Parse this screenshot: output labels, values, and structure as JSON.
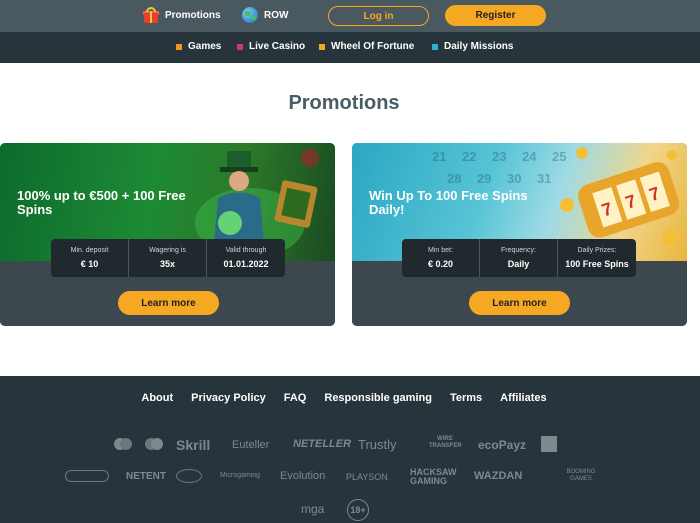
{
  "topbar": {
    "promotions_label": "Promotions",
    "region_label": "ROW",
    "login_label": "Log in",
    "register_label": "Register"
  },
  "nav": {
    "items": [
      {
        "label": "Games",
        "color": "#f5942a"
      },
      {
        "label": "Live Casino",
        "color": "#d6336c"
      },
      {
        "label": "Wheel Of Fortune",
        "color": "#f7a823"
      },
      {
        "label": "Daily Missions",
        "color": "#2bb3d1"
      }
    ]
  },
  "page": {
    "title": "Promotions"
  },
  "cards": [
    {
      "title": "100% up to €500 + 100 Free Spins",
      "stats": [
        {
          "label": "Min. deposit",
          "value": "€ 10"
        },
        {
          "label": "Wagering is",
          "value": "35x"
        },
        {
          "label": "Valid through",
          "value": "01.01.2022"
        }
      ],
      "button_label": "Learn more"
    },
    {
      "title": "Win Up To 100 Free Spins Daily!",
      "stats": [
        {
          "label": "Min bet:",
          "value": "€ 0.20"
        },
        {
          "label": "Frequency:",
          "value": "Daily"
        },
        {
          "label": "Daily Prizes:",
          "value": "100 Free Spins"
        }
      ],
      "button_label": "Learn more"
    }
  ],
  "footer": {
    "links": [
      "About",
      "Privacy Policy",
      "FAQ",
      "Responsible gaming",
      "Terms",
      "Affiliates"
    ],
    "payment_logos": [
      "Skrill",
      "Euteller",
      "NETELLER",
      "Trustly",
      "WIRE TRANSFER",
      "ecoPayz"
    ],
    "provider_logos": [
      "NETENT",
      "Microgaming",
      "Evolution",
      "PLAYSON",
      "HACKSAW GAMING",
      "WAZDAN",
      "BOOMING GAMES"
    ],
    "license_logos": [
      "mga",
      "18+"
    ]
  },
  "colors": {
    "accent": "#f7a823",
    "topbar": "#4a5860",
    "navbar": "#27343b",
    "title": "#4a5c66"
  }
}
